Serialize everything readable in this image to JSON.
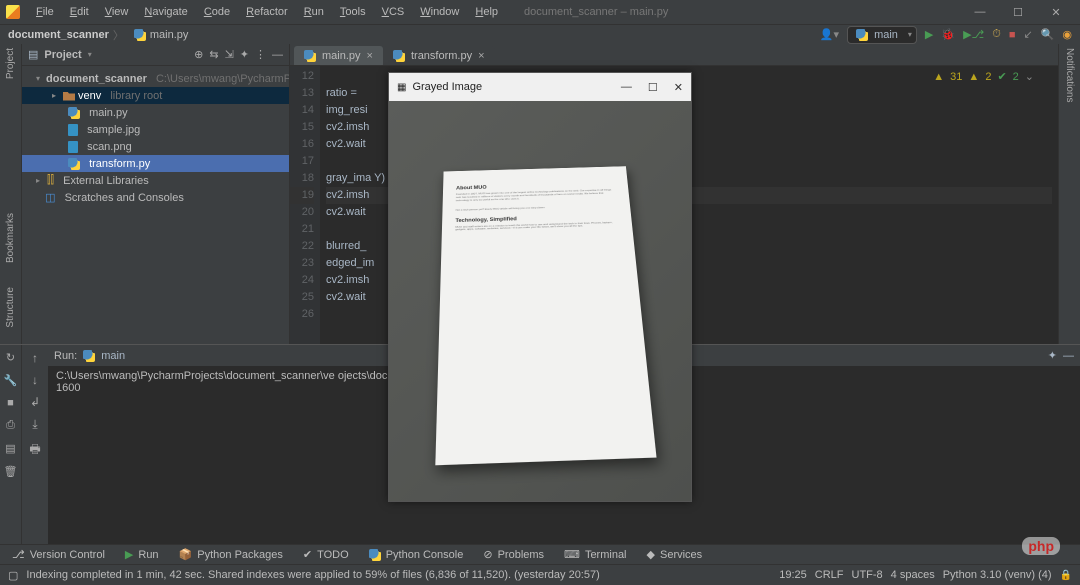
{
  "menu": {
    "file": "File",
    "edit": "Edit",
    "view": "View",
    "navigate": "Navigate",
    "code": "Code",
    "refactor": "Refactor",
    "run": "Run",
    "tools": "Tools",
    "vcs": "VCS",
    "window": "Window",
    "help": "Help"
  },
  "title": "document_scanner – main.py",
  "breadcrumb": {
    "project": "document_scanner",
    "file": "main.py"
  },
  "runconfig": "main",
  "project_panel": {
    "title": "Project",
    "root": {
      "name": "document_scanner",
      "path": "C:\\Users\\mwang\\PycharmProjects"
    },
    "venv": {
      "name": "venv",
      "hint": "library root"
    },
    "files": [
      "main.py",
      "sample.jpg",
      "scan.png",
      "transform.py"
    ],
    "ext_lib": "External Libraries",
    "scratches": "Scratches and Consoles"
  },
  "editor": {
    "tabs": [
      {
        "name": "main.py"
      },
      {
        "name": "transform.py"
      }
    ],
    "line_start": 12,
    "line_count": 15,
    "code_lines": [
      "",
      "ratio =",
      "img_resi",
      "cv2.imsh",
      "cv2.wait",
      "",
      "gray_ima                                       Y)",
      "cv2.imsh",
      "cv2.wait",
      "",
      "blurred_",
      "edged_im",
      "cv2.imsh",
      "cv2.wait",
      ""
    ],
    "inspections": {
      "errors": "31",
      "warnings": "2",
      "ok": "2"
    }
  },
  "run": {
    "title": "Run:",
    "config": "main",
    "out_line1": "C:\\Users\\mwang\\PycharmProjects\\document_scanner\\ve                             ojects\\document_scanner\\main.py",
    "out_line2": "1600"
  },
  "bottom_tabs": {
    "vc": "Version Control",
    "run": "Run",
    "pkg": "Python Packages",
    "todo": "TODO",
    "pycon": "Python Console",
    "prob": "Problems",
    "term": "Terminal",
    "svc": "Services"
  },
  "status": {
    "msg": "Indexing completed in 1 min, 42 sec. Shared indexes were applied to 59% of files (6,836 of 11,520). (yesterday 20:57)",
    "pos": "19:25",
    "crlf": "CRLF",
    "enc": "UTF-8",
    "indent": "4 spaces",
    "interp": "Python 3.10 (venv) (4)"
  },
  "popup": {
    "title": "Grayed Image",
    "doc_h1": "About MUO",
    "doc_h2": "Technology, Simplified"
  },
  "watermark": "php"
}
